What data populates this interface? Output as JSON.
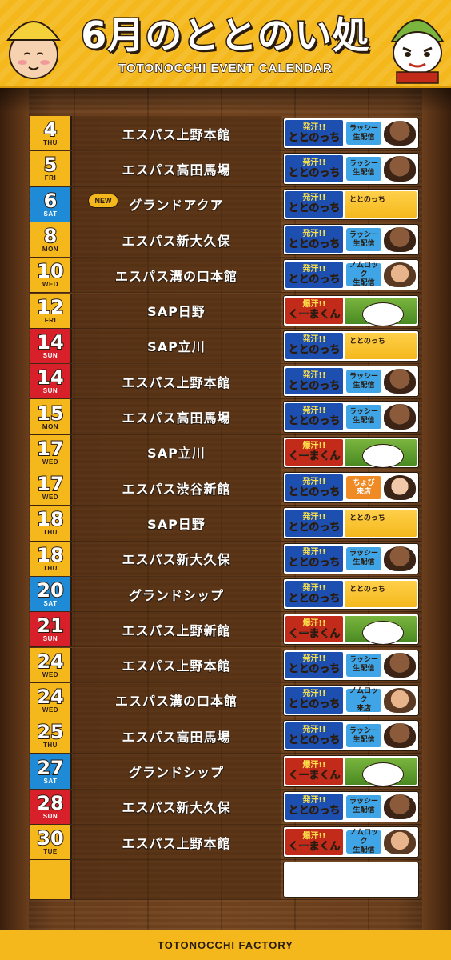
{
  "header": {
    "title": "6月のととのい処",
    "subtitle": "TOTONOCCHI EVENT CALENDAR"
  },
  "footer": {
    "text": "TOTONOCCHI FACTORY"
  },
  "colors": {
    "weekday": "#f4b81c",
    "saturday": "#1f8ad6",
    "sunday": "#d8202a",
    "wood": "#6b3f1d"
  },
  "events": [
    {
      "day": "4",
      "dow": "THU",
      "type": "weekday",
      "venue": "エスパス上野本館",
      "banner": {
        "kind": "hakkan",
        "logo_top": "発汗!!",
        "logo_main": "ととのっち",
        "label": [
          "ラッシー",
          "生配信"
        ],
        "label_color": "blue",
        "face": "person"
      }
    },
    {
      "day": "5",
      "dow": "FRI",
      "type": "weekday",
      "venue": "エスパス高田馬場",
      "banner": {
        "kind": "hakkan",
        "logo_top": "発汗!!",
        "logo_main": "ととのっち",
        "label": [
          "ラッシー",
          "生配信"
        ],
        "label_color": "blue",
        "face": "person"
      }
    },
    {
      "day": "6",
      "dow": "SAT",
      "type": "sat",
      "venue": "グランドアクア",
      "new": "NEW",
      "banner": {
        "kind": "mascot",
        "logo_top": "発汗!!",
        "logo_main": "ととのっち",
        "mascot_text": "ととのっち"
      }
    },
    {
      "day": "8",
      "dow": "MON",
      "type": "weekday",
      "venue": "エスパス新大久保",
      "banner": {
        "kind": "hakkan",
        "logo_top": "発汗!!",
        "logo_main": "ととのっち",
        "label": [
          "ラッシー",
          "生配信"
        ],
        "label_color": "blue",
        "face": "person"
      }
    },
    {
      "day": "10",
      "dow": "WED",
      "type": "weekday",
      "venue": "エスパス溝の口本館",
      "banner": {
        "kind": "hakkan",
        "logo_top": "発汗!!",
        "logo_main": "ととのっち",
        "label": [
          "ノムロック",
          "生配信"
        ],
        "label_color": "blue",
        "face": "glasses"
      }
    },
    {
      "day": "12",
      "dow": "FRI",
      "type": "weekday",
      "venue": "SAP日野",
      "banner": {
        "kind": "kumakun",
        "logo_top": "爆汗!!",
        "logo_main": "くーまくん"
      }
    },
    {
      "day": "14",
      "dow": "SUN",
      "type": "sun",
      "venue": "SAP立川",
      "banner": {
        "kind": "mascot",
        "logo_top": "発汗!!",
        "logo_main": "ととのっち",
        "mascot_text": "ととのっち"
      }
    },
    {
      "day": "14",
      "dow": "SUN",
      "type": "sun",
      "venue": "エスパス上野本館",
      "banner": {
        "kind": "hakkan",
        "logo_top": "発汗!!",
        "logo_main": "ととのっち",
        "label": [
          "ラッシー",
          "生配信"
        ],
        "label_color": "blue",
        "face": "person"
      }
    },
    {
      "day": "15",
      "dow": "MON",
      "type": "weekday",
      "venue": "エスパス高田馬場",
      "banner": {
        "kind": "hakkan",
        "logo_top": "発汗!!",
        "logo_main": "ととのっち",
        "label": [
          "ラッシー",
          "生配信"
        ],
        "label_color": "blue",
        "face": "person"
      }
    },
    {
      "day": "17",
      "dow": "WED",
      "type": "weekday",
      "venue": "SAP立川",
      "banner": {
        "kind": "kumakun",
        "logo_top": "爆汗!!",
        "logo_main": "くーまくん"
      }
    },
    {
      "day": "17",
      "dow": "WED",
      "type": "weekday",
      "venue": "エスパス渋谷新館",
      "banner": {
        "kind": "hakkan",
        "logo_top": "発汗!!",
        "logo_main": "ととのっち",
        "label": [
          "ちょび",
          "来店"
        ],
        "label_color": "orange",
        "face": "woman"
      }
    },
    {
      "day": "18",
      "dow": "THU",
      "type": "weekday",
      "venue": "SAP日野",
      "banner": {
        "kind": "mascot",
        "logo_top": "発汗!!",
        "logo_main": "ととのっち",
        "mascot_text": "ととのっち"
      }
    },
    {
      "day": "18",
      "dow": "THU",
      "type": "weekday",
      "venue": "エスパス新大久保",
      "banner": {
        "kind": "hakkan",
        "logo_top": "発汗!!",
        "logo_main": "ととのっち",
        "label": [
          "ラッシー",
          "生配信"
        ],
        "label_color": "blue",
        "face": "person"
      }
    },
    {
      "day": "20",
      "dow": "SAT",
      "type": "sat",
      "venue": "グランドシップ",
      "banner": {
        "kind": "mascot",
        "logo_top": "発汗!!",
        "logo_main": "ととのっち",
        "mascot_text": "ととのっち"
      }
    },
    {
      "day": "21",
      "dow": "SUN",
      "type": "sun",
      "venue": "エスパス上野新館",
      "banner": {
        "kind": "kumakun",
        "logo_top": "爆汗!!",
        "logo_main": "くーまくん"
      }
    },
    {
      "day": "24",
      "dow": "WED",
      "type": "weekday",
      "venue": "エスパス上野本館",
      "banner": {
        "kind": "hakkan",
        "logo_top": "発汗!!",
        "logo_main": "ととのっち",
        "label": [
          "ラッシー",
          "生配信"
        ],
        "label_color": "blue",
        "face": "person"
      }
    },
    {
      "day": "24",
      "dow": "WED",
      "type": "weekday",
      "venue": "エスパス溝の口本館",
      "banner": {
        "kind": "hakkan",
        "logo_top": "発汗!!",
        "logo_main": "ととのっち",
        "label": [
          "ノムロック",
          "来店"
        ],
        "label_color": "blue",
        "face": "glasses"
      }
    },
    {
      "day": "25",
      "dow": "THU",
      "type": "weekday",
      "venue": "エスパス高田馬場",
      "banner": {
        "kind": "hakkan",
        "logo_top": "発汗!!",
        "logo_main": "ととのっち",
        "label": [
          "ラッシー",
          "生配信"
        ],
        "label_color": "blue",
        "face": "person"
      }
    },
    {
      "day": "27",
      "dow": "SAT",
      "type": "sat",
      "venue": "グランドシップ",
      "banner": {
        "kind": "kumakun",
        "logo_top": "爆汗!!",
        "logo_main": "くーまくん"
      }
    },
    {
      "day": "28",
      "dow": "SUN",
      "type": "sun",
      "venue": "エスパス新大久保",
      "banner": {
        "kind": "hakkan",
        "logo_top": "発汗!!",
        "logo_main": "ととのっち",
        "label": [
          "ラッシー",
          "生配信"
        ],
        "label_color": "blue",
        "face": "person"
      }
    },
    {
      "day": "30",
      "dow": "TUE",
      "type": "weekday",
      "venue": "エスパス上野本館",
      "banner": {
        "kind": "bakuhan-label",
        "logo_top": "爆汗!!",
        "logo_main": "くーまくん",
        "label": [
          "ノムロック",
          "生配信"
        ],
        "label_color": "blue",
        "face": "glasses"
      }
    }
  ]
}
